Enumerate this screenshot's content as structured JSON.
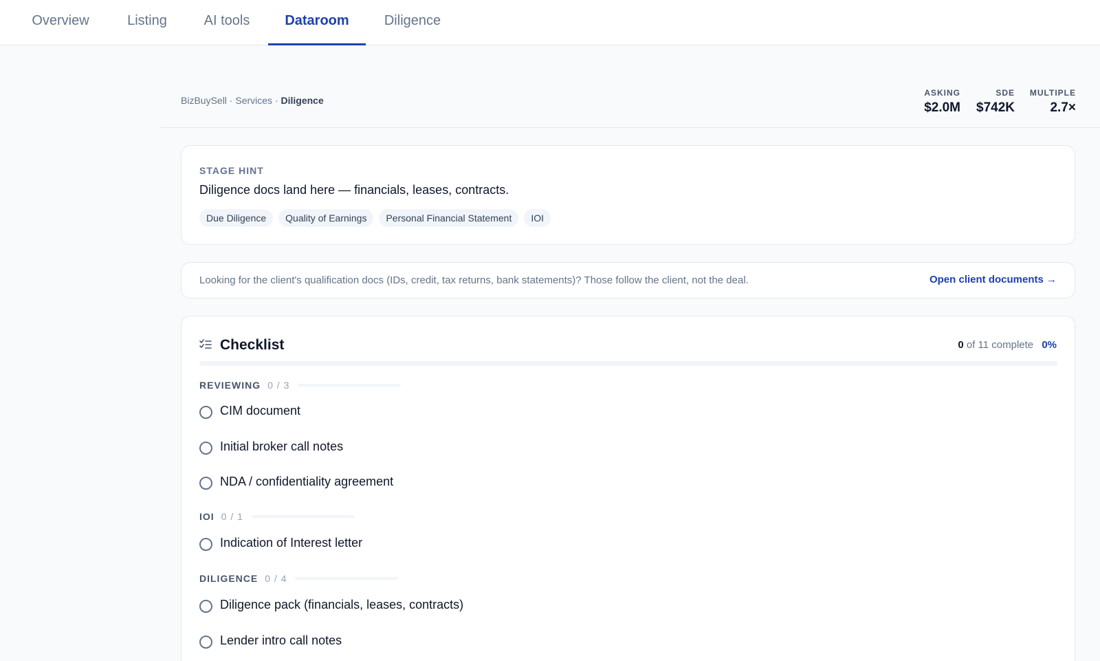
{
  "tabs": [
    {
      "label": "Overview"
    },
    {
      "label": "Listing"
    },
    {
      "label": "AI tools"
    },
    {
      "label": "Dataroom",
      "active": true
    },
    {
      "label": "Diligence"
    }
  ],
  "breadcrumb": {
    "parts": [
      "BizBuySell",
      "Services"
    ],
    "sep": " · ",
    "current": "Diligence"
  },
  "metrics": {
    "asking": {
      "label": "ASKING",
      "value": "$2.0M"
    },
    "sde": {
      "label": "SDE",
      "value": "$742K"
    },
    "multiple": {
      "label": "MULTIPLE",
      "value": "2.7×"
    }
  },
  "stage_hint": {
    "label": "STAGE HINT",
    "text": "Diligence docs land here — financials, leases, contracts.",
    "chips": [
      "Due Diligence",
      "Quality of Earnings",
      "Personal Financial Statement",
      "IOI"
    ]
  },
  "client_note": {
    "text": "Looking for the client's qualification docs (IDs, credit, tax returns, bank statements)? Those follow the client, not the deal.",
    "link": "Open client documents →"
  },
  "checklist": {
    "title": "Checklist",
    "complete": "0",
    "of_text": "of 11 complete",
    "percent": "0%",
    "progress_fraction": 0,
    "groups": [
      {
        "name": "REVIEWING",
        "count": "0 / 3",
        "items": [
          "CIM document",
          "Initial broker call notes",
          "NDA / confidentiality agreement"
        ]
      },
      {
        "name": "IOI",
        "count": "0 / 1",
        "items": [
          "Indication of Interest letter"
        ]
      },
      {
        "name": "DILIGENCE",
        "count": "0 / 4",
        "items": [
          "Diligence pack (financials, leases, contracts)",
          "Lender intro call notes"
        ]
      }
    ]
  },
  "colors": {
    "accent": "#1e40af",
    "muted": "#64748b"
  }
}
